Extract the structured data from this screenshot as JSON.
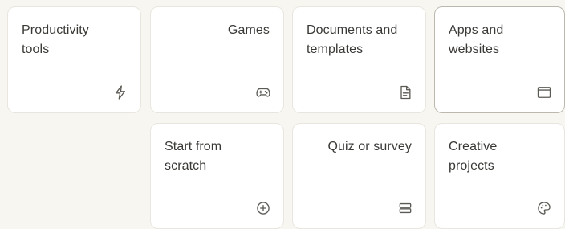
{
  "cards": [
    {
      "label": "Productivity tools",
      "icon": "lightning-bolt-icon"
    },
    {
      "label": "Games",
      "icon": "gamepad-icon"
    },
    {
      "label": "Documents and templates",
      "icon": "document-icon"
    },
    {
      "label": "Apps and websites",
      "icon": "browser-window-icon",
      "selected": true
    },
    {
      "label": "Start from scratch",
      "icon": "plus-circle-icon"
    },
    {
      "label": "Quiz or survey",
      "icon": "list-icon"
    },
    {
      "label": "Creative projects",
      "icon": "palette-icon"
    }
  ],
  "colors": {
    "background": "#f8f6f1",
    "card": "#ffffff",
    "card_border": "#e9e6df",
    "selected_border": "#bdb8ae",
    "text": "#3a3936",
    "icon": "#5b5a55"
  }
}
